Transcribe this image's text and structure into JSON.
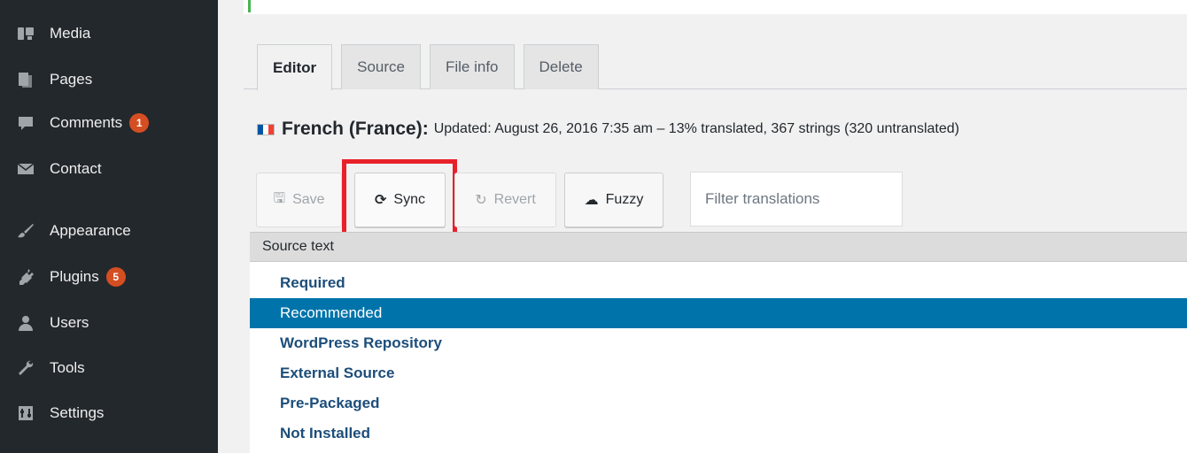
{
  "sidebar": {
    "items": [
      {
        "label": "Media",
        "icon": "media-icon"
      },
      {
        "label": "Pages",
        "icon": "pages-icon"
      },
      {
        "label": "Comments",
        "icon": "comments-icon",
        "badge": "1"
      },
      {
        "label": "Contact",
        "icon": "envelope-icon"
      },
      {
        "label": "Appearance",
        "icon": "paintbrush-icon"
      },
      {
        "label": "Plugins",
        "icon": "plugin-icon",
        "badge": "5"
      },
      {
        "label": "Users",
        "icon": "users-icon"
      },
      {
        "label": "Tools",
        "icon": "wrench-icon"
      },
      {
        "label": "Settings",
        "icon": "settings-icon"
      }
    ]
  },
  "tabs": [
    {
      "label": "Editor",
      "active": true
    },
    {
      "label": "Source",
      "active": false
    },
    {
      "label": "File info",
      "active": false
    },
    {
      "label": "Delete",
      "active": false
    }
  ],
  "header": {
    "language": "French (France):",
    "detail": "Updated: August 26, 2016 7:35 am – 13% translated, 367 strings (320 untranslated)",
    "flag_colors": [
      "#0055a4",
      "#ffffff",
      "#ef4135"
    ]
  },
  "toolbar": {
    "save_label": "Save",
    "sync_label": "Sync",
    "revert_label": "Revert",
    "fuzzy_label": "Fuzzy",
    "filter_placeholder": "Filter translations",
    "highlight_color": "#e8202a"
  },
  "table": {
    "header": "Source text",
    "rows": [
      {
        "text": "Required",
        "selected": false
      },
      {
        "text": "Recommended",
        "selected": true
      },
      {
        "text": "WordPress Repository",
        "selected": false
      },
      {
        "text": "External Source",
        "selected": false
      },
      {
        "text": "Pre-Packaged",
        "selected": false
      },
      {
        "text": "Not Installed",
        "selected": false
      }
    ]
  },
  "colors": {
    "sidebar_bg": "#23282d",
    "badge": "#d54e21",
    "selected_row": "#0073aa",
    "link_text": "#1c4d7a"
  }
}
